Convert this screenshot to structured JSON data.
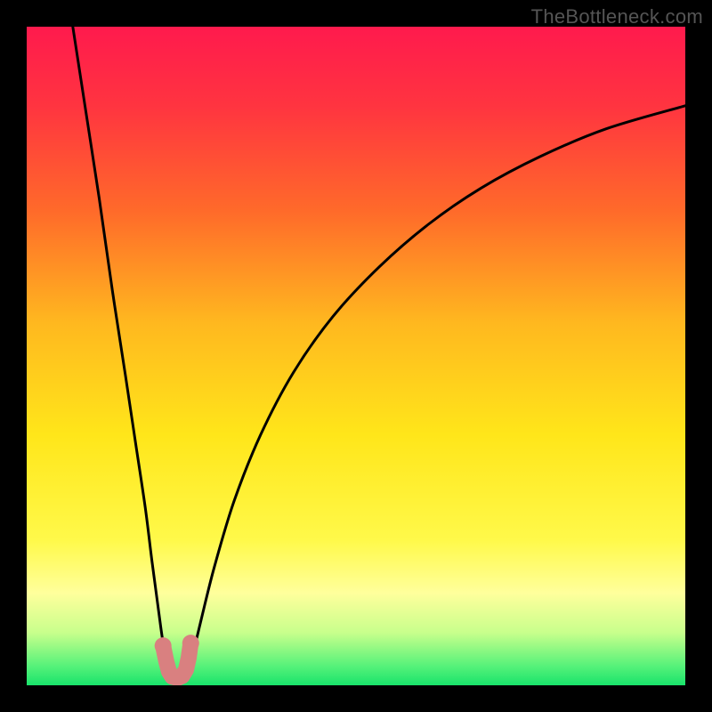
{
  "watermark": "TheBottleneck.com",
  "chart_data": {
    "type": "line",
    "title": "",
    "xlabel": "",
    "ylabel": "",
    "xlim": [
      0,
      100
    ],
    "ylim": [
      0,
      100
    ],
    "grid": false,
    "legend": false,
    "background_gradient": {
      "stops": [
        {
          "offset": 0.0,
          "color": "#ff1a4d"
        },
        {
          "offset": 0.12,
          "color": "#ff3440"
        },
        {
          "offset": 0.28,
          "color": "#ff6a2a"
        },
        {
          "offset": 0.45,
          "color": "#ffb81f"
        },
        {
          "offset": 0.62,
          "color": "#ffe61a"
        },
        {
          "offset": 0.78,
          "color": "#fff94a"
        },
        {
          "offset": 0.86,
          "color": "#ffff9c"
        },
        {
          "offset": 0.92,
          "color": "#c8ff8c"
        },
        {
          "offset": 0.97,
          "color": "#58f27a"
        },
        {
          "offset": 1.0,
          "color": "#19e36b"
        }
      ]
    },
    "series": [
      {
        "name": "left-branch",
        "color": "#000000",
        "x": [
          7.0,
          9.0,
          11.0,
          13.0,
          15.0,
          16.5,
          18.0,
          19.0,
          19.8,
          20.4,
          20.9,
          21.2,
          21.5
        ],
        "y": [
          100.0,
          87.0,
          74.0,
          60.0,
          47.0,
          37.0,
          27.0,
          19.0,
          13.0,
          8.5,
          5.0,
          2.8,
          1.7
        ]
      },
      {
        "name": "right-branch",
        "color": "#000000",
        "x": [
          24.5,
          25.3,
          26.5,
          28.5,
          31.5,
          35.5,
          40.5,
          46.5,
          53.5,
          61.0,
          69.0,
          78.0,
          88.0,
          100.0
        ],
        "y": [
          2.0,
          5.0,
          10.0,
          18.0,
          28.0,
          38.0,
          47.5,
          56.0,
          63.5,
          70.0,
          75.5,
          80.3,
          84.5,
          88.0
        ]
      },
      {
        "name": "highlight-markers",
        "color": "#d98080",
        "marker": "round",
        "x": [
          20.7,
          21.2,
          21.6,
          22.1,
          22.9,
          23.6,
          24.2,
          24.6,
          24.9
        ],
        "y": [
          6.0,
          3.6,
          2.1,
          1.3,
          1.1,
          1.4,
          2.4,
          4.2,
          6.4
        ]
      }
    ]
  }
}
